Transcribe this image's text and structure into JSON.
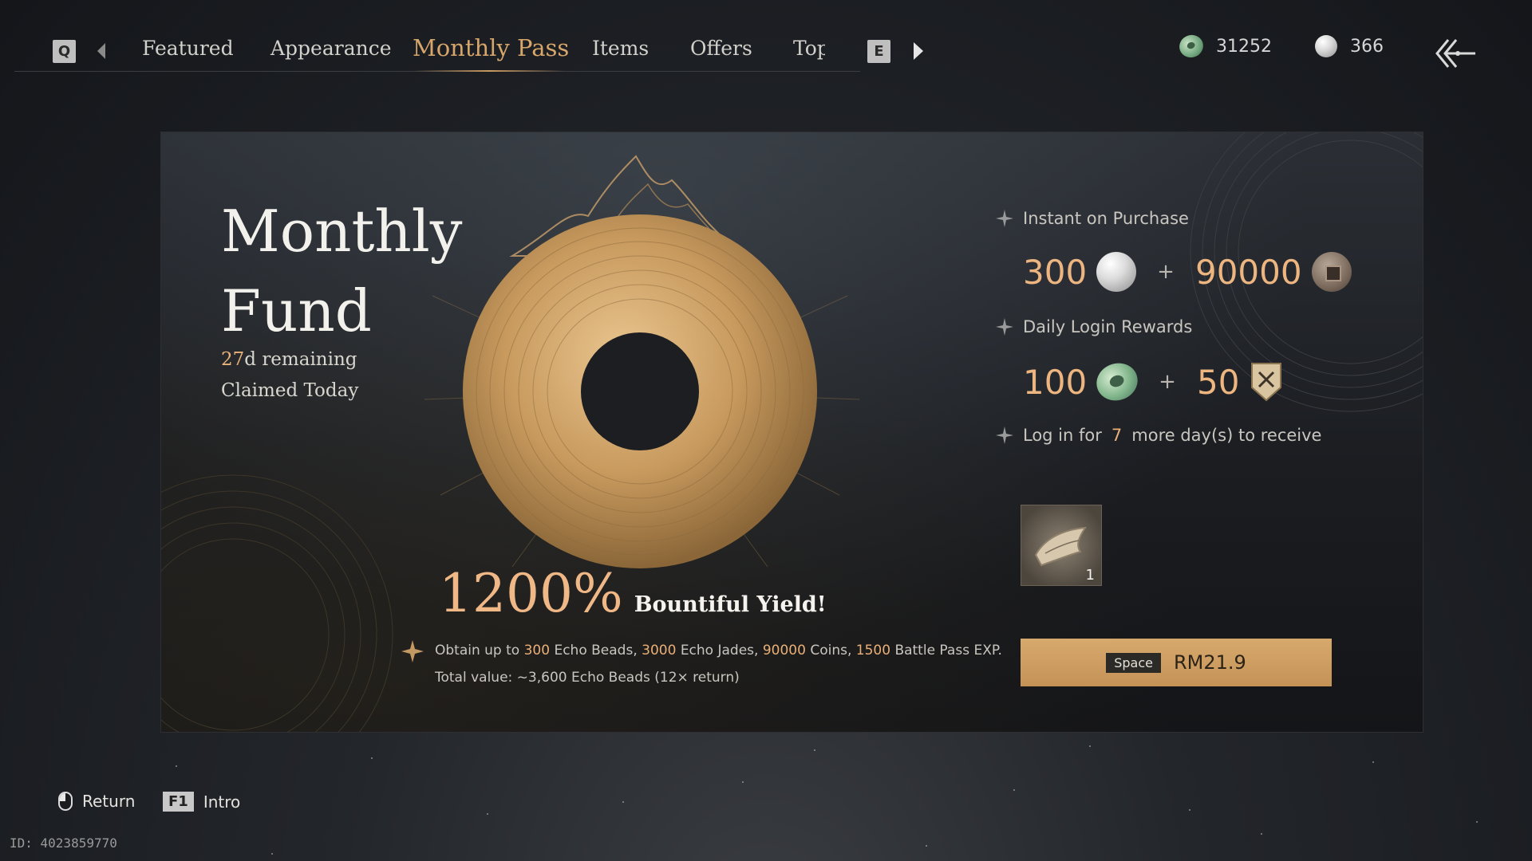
{
  "nav": {
    "key_left": "Q",
    "key_right": "E",
    "tabs": [
      "Featured",
      "Appearance",
      "Monthly Pass",
      "Items",
      "Offers",
      "Top"
    ],
    "active_tab": "Monthly Pass"
  },
  "currency": {
    "jade_amount": "31252",
    "pearl_amount": "366"
  },
  "panel": {
    "title_line1": "Monthly",
    "title_line2": "Fund",
    "days_remaining": "27",
    "days_suffix": "d remaining",
    "claimed_status": "Claimed Today",
    "yield_percent": "1200%",
    "yield_label": "Bountiful Yield!",
    "obtain": {
      "prefix": "Obtain up to",
      "beads": "300",
      "beads_label": "Echo Beads,",
      "jades": "3000",
      "jades_label": "Echo Jades,",
      "coins": "90000",
      "coins_label": "Coins,",
      "exp": "1500",
      "exp_label": "Battle Pass EXP.",
      "total": "Total value: ~3,600 Echo Beads (12× return)"
    },
    "instant": {
      "heading": "Instant on Purchase",
      "amount1": "300",
      "amount2": "90000"
    },
    "daily": {
      "heading": "Daily Login Rewards",
      "amount1": "100",
      "amount2": "50"
    },
    "login": {
      "prefix": "Log in for",
      "days": "7",
      "suffix": "more day(s) to receive",
      "item_count": "1"
    },
    "buy": {
      "key": "Space",
      "price": "RM21.9"
    }
  },
  "footer": {
    "return_label": "Return",
    "intro_key": "F1",
    "intro_label": "Intro",
    "uid": "ID: 4023859770"
  },
  "colors": {
    "accent_gold": "#d7a66b",
    "number_gold": "#edb580",
    "button_gold": "#c99a61"
  },
  "plus_sign": "+"
}
